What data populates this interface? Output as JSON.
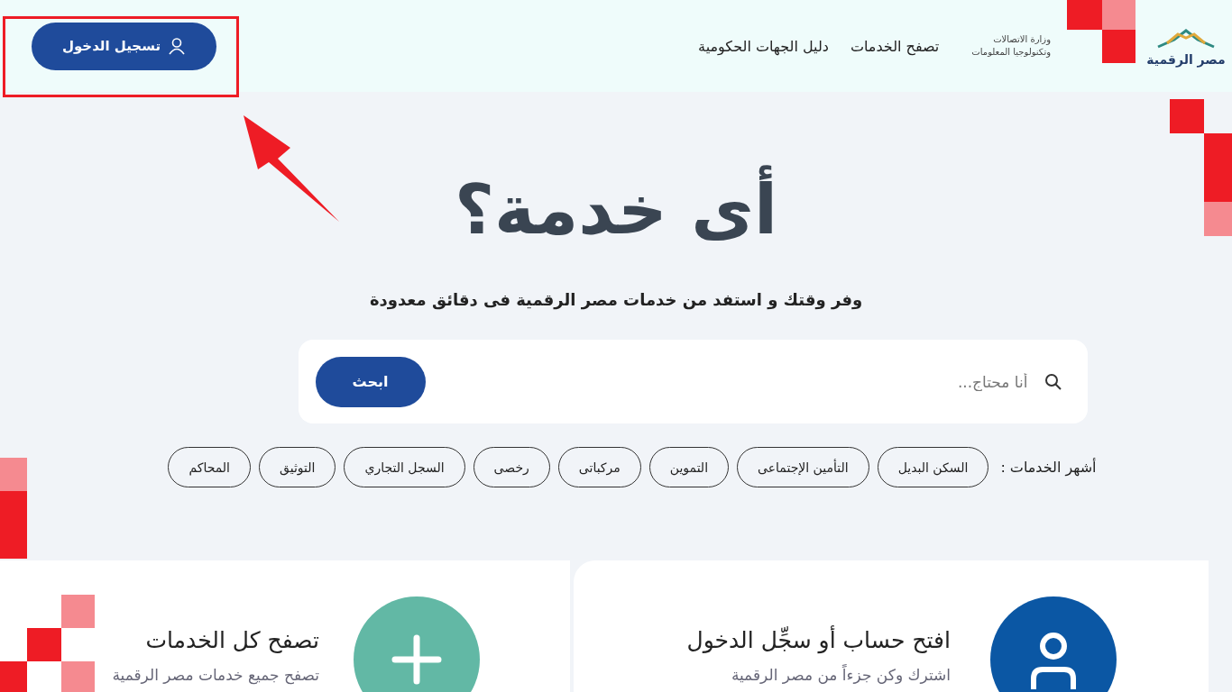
{
  "header": {
    "logo_text": "مصر الرقمية",
    "ministry_text": [
      "وزارة الاتصالات",
      "وتكنولوجيا المعلومات"
    ],
    "nav": [
      "تصفح الخدمات",
      "دليل الجهات الحكومية"
    ],
    "login_button": "تسجيل الدخول"
  },
  "hero": {
    "title": "أى خدمة؟",
    "subtitle": "وفر وقتك و استفد من خدمات مصر الرقمية فى دقائق معدودة",
    "search": {
      "placeholder": "أنا محتاج...",
      "button": "ابحث"
    },
    "popular": {
      "label": "أشهر الخدمات :",
      "chips": [
        "السكن البديل",
        "التأمين الإجتماعى",
        "التموين",
        "مركباتى",
        "رخصى",
        "السجل التجاري",
        "التوثيق",
        "المحاكم"
      ]
    }
  },
  "cards": [
    {
      "kind": "account",
      "title": "افتح حساب أو سجِّل الدخول",
      "text": "اشترك وكن جزءاً من مصر الرقمية"
    },
    {
      "kind": "browse",
      "title": "تصفح كل الخدمات",
      "text": "تصفح جميع خدمات مصر الرقمية"
    }
  ]
}
